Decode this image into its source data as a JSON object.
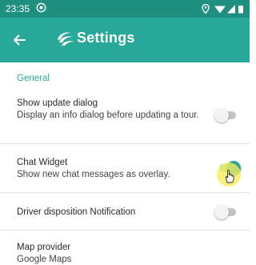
{
  "status_bar": {
    "time": "23:35",
    "icons": [
      "at-sign-icon",
      "location-icon",
      "wifi-icon",
      "signal-icon",
      "battery-icon"
    ]
  },
  "app_bar": {
    "title": "Settings",
    "back_icon": "arrow-left-icon",
    "logo_icon": "swoosh-logo-icon",
    "color": "#27a898",
    "status_color": "#1f8f80"
  },
  "section": {
    "title": "General"
  },
  "settings": [
    {
      "title": "Show update dialog",
      "subtitle": "Display an info dialog before updating a tour.",
      "enabled": false
    },
    {
      "title": "Chat Widget",
      "subtitle": "Show new chat messages as overlay.",
      "enabled": true
    },
    {
      "title": "Driver disposition Notification",
      "enabled": false
    },
    {
      "title": "Map provider",
      "value": "Google Maps"
    }
  ],
  "colors": {
    "accent": "#27a898",
    "switch_off": "#c4c4c4",
    "touch_indicator": "#f8ec58"
  }
}
